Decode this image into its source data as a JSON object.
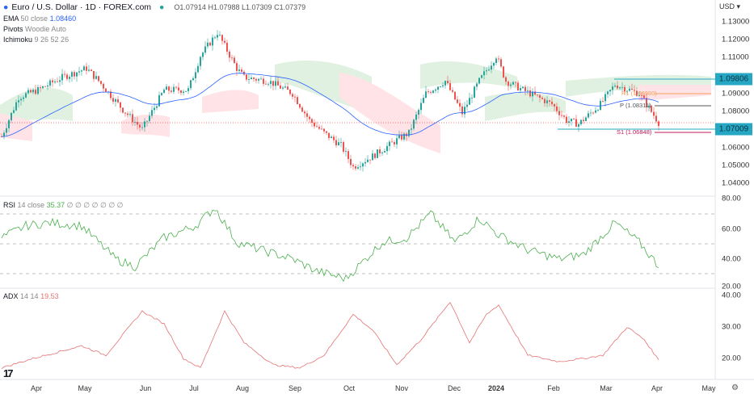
{
  "header": {
    "symbol": "Euro / U.S. Dollar · 1D · FOREX.com",
    "open": "O1.07914",
    "high": "H1.07988",
    "low": "L1.07309",
    "close": "C1.07379",
    "indicators": [
      {
        "name": "EMA",
        "params": "50 close",
        "value": "1.08460"
      },
      {
        "name": "Pivots",
        "params": "Woodie Auto",
        "value": ""
      },
      {
        "name": "Ichimoku",
        "params": "9 26 52 26",
        "value": ""
      }
    ]
  },
  "price_axis": {
    "currency": "USD",
    "ticks": [
      "1.13000",
      "1.12000",
      "1.11000",
      "1.09000",
      "1.08000",
      "1.06000",
      "1.05000",
      "1.04000"
    ],
    "tag_high": "1.09806",
    "tag_low": "1.07009"
  },
  "pivots": {
    "r1": "R1 (1.08980)",
    "p": "P (1.08311)",
    "s1": "S1 (1.06848)"
  },
  "rsi": {
    "label": "RSI",
    "params": "14 close",
    "value": "35.37",
    "extras": "∅ ∅ ∅ ∅ ∅ ∅ ∅",
    "ticks": [
      "80.00",
      "60.00",
      "40.00",
      "20.00"
    ]
  },
  "adx": {
    "label": "ADX",
    "params": "14 14",
    "value": "19.53",
    "ticks": [
      "40.00",
      "30.00",
      "20.00"
    ]
  },
  "time_axis": [
    "Apr",
    "May",
    "Jun",
    "Jul",
    "Aug",
    "Sep",
    "Oct",
    "Nov",
    "Dec",
    "2024",
    "Feb",
    "Mar",
    "Apr",
    "May"
  ],
  "colors": {
    "up": "#26a69a",
    "down": "#ef5350",
    "ema": "#2962ff",
    "rsi": "#4caf50",
    "adx": "#e57373",
    "tag": "#26a7c4"
  },
  "chart_data": [
    {
      "type": "candlestick",
      "title": "EUR/USD 1D",
      "ylim": [
        1.035,
        1.135
      ],
      "close_waypoints": [
        [
          0,
          1.066
        ],
        [
          7,
          1.088
        ],
        [
          15,
          1.092
        ],
        [
          25,
          1.099
        ],
        [
          35,
          1.104
        ],
        [
          40,
          1.097
        ],
        [
          50,
          1.081
        ],
        [
          58,
          1.07
        ],
        [
          67,
          1.092
        ],
        [
          77,
          1.092
        ],
        [
          82,
          1.111
        ],
        [
          89,
          1.124
        ],
        [
          97,
          1.104
        ],
        [
          100,
          1.099
        ],
        [
          110,
          1.097
        ],
        [
          120,
          1.09
        ],
        [
          127,
          1.075
        ],
        [
          133,
          1.068
        ],
        [
          140,
          1.061
        ],
        [
          145,
          1.049
        ],
        [
          153,
          1.055
        ],
        [
          163,
          1.064
        ],
        [
          168,
          1.068
        ],
        [
          175,
          1.09
        ],
        [
          183,
          1.097
        ],
        [
          190,
          1.079
        ],
        [
          197,
          1.097
        ],
        [
          204,
          1.111
        ],
        [
          208,
          1.097
        ],
        [
          215,
          1.092
        ],
        [
          227,
          1.084
        ],
        [
          233,
          1.075
        ],
        [
          238,
          1.073
        ],
        [
          247,
          1.084
        ],
        [
          253,
          1.095
        ],
        [
          263,
          1.09
        ],
        [
          271,
          1.0738
        ]
      ]
    },
    {
      "type": "line",
      "title": "RSI 14",
      "ylim": [
        20,
        80
      ],
      "waypoints": [
        [
          0,
          54
        ],
        [
          10,
          62
        ],
        [
          20,
          64
        ],
        [
          33,
          62
        ],
        [
          47,
          40
        ],
        [
          55,
          35
        ],
        [
          67,
          54
        ],
        [
          80,
          62
        ],
        [
          88,
          74
        ],
        [
          97,
          51
        ],
        [
          107,
          46
        ],
        [
          120,
          40
        ],
        [
          130,
          32
        ],
        [
          142,
          27
        ],
        [
          157,
          51
        ],
        [
          167,
          54
        ],
        [
          177,
          70
        ],
        [
          187,
          51
        ],
        [
          197,
          67
        ],
        [
          205,
          56
        ],
        [
          217,
          46
        ],
        [
          230,
          40
        ],
        [
          240,
          43
        ],
        [
          253,
          64
        ],
        [
          263,
          51
        ],
        [
          271,
          35.37
        ]
      ]
    },
    {
      "type": "line",
      "title": "ADX 14",
      "ylim": [
        15,
        40
      ],
      "waypoints": [
        [
          0,
          17
        ],
        [
          13,
          20
        ],
        [
          33,
          24
        ],
        [
          43,
          21
        ],
        [
          58,
          35
        ],
        [
          67,
          31
        ],
        [
          75,
          20
        ],
        [
          82,
          17
        ],
        [
          92,
          35
        ],
        [
          100,
          25
        ],
        [
          112,
          18
        ],
        [
          123,
          17
        ],
        [
          133,
          21
        ],
        [
          145,
          34
        ],
        [
          153,
          29
        ],
        [
          163,
          18
        ],
        [
          173,
          26
        ],
        [
          185,
          38
        ],
        [
          193,
          25
        ],
        [
          200,
          34
        ],
        [
          205,
          37
        ],
        [
          217,
          21
        ],
        [
          230,
          19
        ],
        [
          240,
          20
        ],
        [
          248,
          21
        ],
        [
          258,
          30
        ],
        [
          265,
          26
        ],
        [
          271,
          19.53
        ]
      ]
    }
  ]
}
